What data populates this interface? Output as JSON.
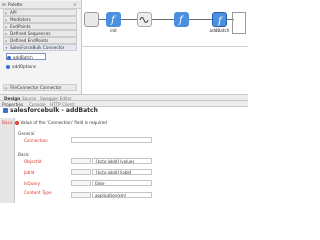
{
  "palette": {
    "title": "Palette",
    "items": [
      {
        "label": "API"
      },
      {
        "label": "Mediators"
      },
      {
        "label": "EndPoints"
      },
      {
        "label": "Defined Sequences"
      },
      {
        "label": "Defined EndPoints"
      },
      {
        "label": "SalesForceBulk Connector"
      }
    ],
    "sub_items": [
      {
        "label": "addBatch"
      },
      {
        "label": "addOptions"
      }
    ],
    "last_item": {
      "label": "FileConnector Connector"
    }
  },
  "canvas": {
    "nodes": [
      {
        "label": "init"
      },
      {
        "label": "addBatch"
      }
    ]
  },
  "design_bar": {
    "design": "Design",
    "source": "Source",
    "swagger": "Swagger Editor"
  },
  "properties": {
    "tabs": {
      "properties": "Properties",
      "console": "Console",
      "http_client": "HTTP Client"
    },
    "title": "salesforcebulk - addBatch",
    "side_tab": "Basic",
    "error": "Value of the 'Connection' field is required",
    "general_label": "General",
    "connection_label": "Connection",
    "basic_label": "Basic",
    "rows": [
      {
        "label": "ObjectId",
        "value": "{$ctx:jobId}/values",
        "picker": "..."
      },
      {
        "label": "JobId",
        "value": "{$ctx:jobId}/jobId",
        "picker": "..."
      },
      {
        "label": "IsQuery",
        "value": "false",
        "picker": "..."
      },
      {
        "label": "Content Type",
        "value": "application/xml",
        "picker": "..."
      }
    ]
  },
  "colors": {
    "accent": "#3b6fd1",
    "error": "#d9342b",
    "node_fill": "#4a8fe0"
  }
}
